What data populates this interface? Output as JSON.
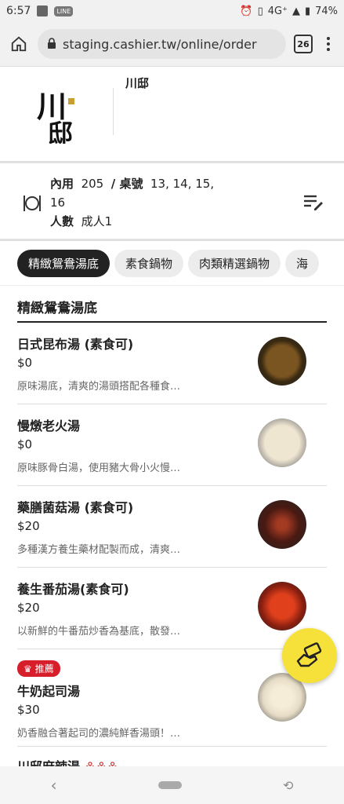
{
  "status": {
    "time": "6:57",
    "network": "4G⁺",
    "battery": "74%",
    "app_badge": "LINE"
  },
  "browser": {
    "url": "staging.cashier.tw/online/order",
    "tab_count": "26"
  },
  "store": {
    "name": "川邸",
    "logo_text": "川邸"
  },
  "order": {
    "dine_label": "內用",
    "dine_number": "205",
    "table_label": "/ 桌號",
    "table_numbers": "13, 14, 15,",
    "table_numbers_cont": "16",
    "people_label": "人數",
    "people_value": "成人1"
  },
  "categories": [
    {
      "label": "精緻鴛鴦湯底",
      "active": true
    },
    {
      "label": "素食鍋物",
      "active": false
    },
    {
      "label": "肉類精選鍋物",
      "active": false
    },
    {
      "label": "海",
      "active": false
    }
  ],
  "section": {
    "title": "精緻鴛鴦湯底"
  },
  "items": [
    {
      "name": "日式昆布湯 (素食可)",
      "price": "$0",
      "desc": "原味湯底，清爽的湯頭搭配各種食…",
      "color": "#6b4a1e"
    },
    {
      "name": "慢燉老火湯",
      "price": "$0",
      "desc": "原味豚骨白湯，使用豬大骨小火慢…",
      "color": "#e8ddc8"
    },
    {
      "name": "藥膳菌菇湯 (素食可)",
      "price": "$20",
      "desc": "多種漢方養生藥材配製而成，清爽…",
      "color": "#4a1a12"
    },
    {
      "name": "養生番茄湯(素食可)",
      "price": "$20",
      "desc": "以新鮮的牛番茄炒香為基底，散發…",
      "color": "#b52a12"
    }
  ],
  "recommended_item": {
    "badge": "推薦",
    "name": "牛奶起司湯",
    "price": "$30",
    "desc": "奶香融合著起司的濃純鮮香湯頭！…",
    "color": "#efe6d6"
  },
  "partial_item": {
    "name": "川邸麻辣湯"
  },
  "colors": {
    "accent": "#222222",
    "badge_red": "#d61f2a",
    "fab_yellow": "#f6e13a"
  }
}
